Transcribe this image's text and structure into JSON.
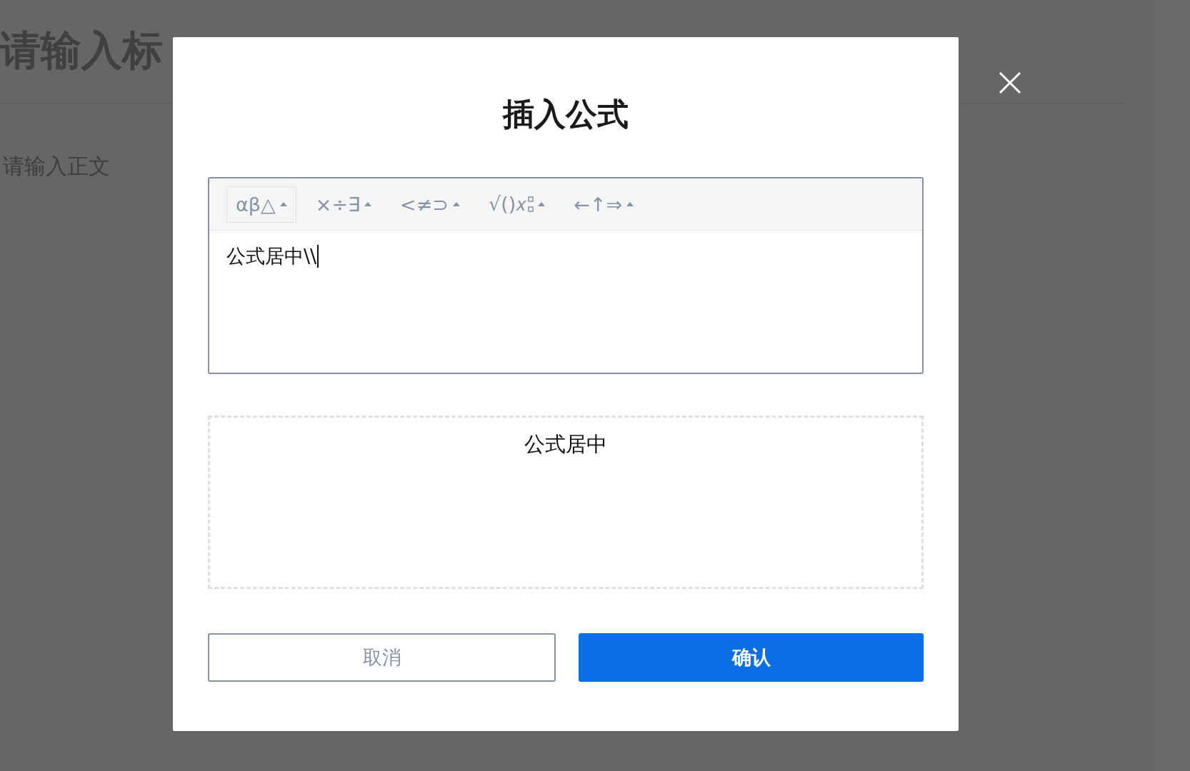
{
  "background_page": {
    "title": "请输入标",
    "body_placeholder": "请输入正文"
  },
  "dialog": {
    "title": "插入公式",
    "toolbar": [
      {
        "label": "αβ△",
        "selected": true,
        "kind": "plain"
      },
      {
        "label": "×÷∃",
        "selected": false,
        "kind": "plain"
      },
      {
        "label": "<≠⊃",
        "selected": false,
        "kind": "plain"
      },
      {
        "label": "√()𝑥",
        "selected": false,
        "kind": "scripts"
      },
      {
        "label": "←↑⇒",
        "selected": false,
        "kind": "plain"
      }
    ],
    "editor": {
      "value": "公式居中\\\\"
    },
    "preview": {
      "text": "公式居中"
    },
    "buttons": [
      {
        "label": "取消",
        "kind": "secondary"
      },
      {
        "label": "确认",
        "kind": "primary"
      }
    ]
  }
}
